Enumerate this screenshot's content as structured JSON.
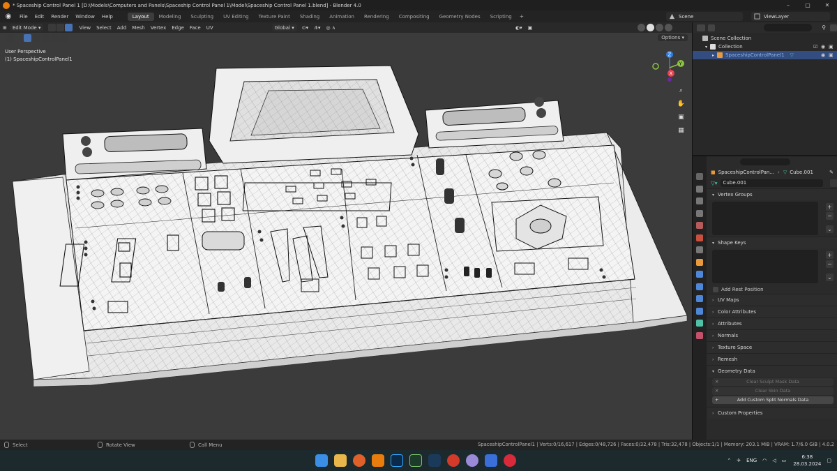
{
  "window": {
    "title": "* Spaceship Control Panel 1 [D:\\Models\\Computers and Panels\\Spaceship Control Panel 1\\Model\\Spaceship Control Panel 1.blend] - Blender 4.0"
  },
  "menu": [
    "File",
    "Edit",
    "Render",
    "Window",
    "Help"
  ],
  "workspaces": [
    "Layout",
    "Modeling",
    "Sculpting",
    "UV Editing",
    "Texture Paint",
    "Shading",
    "Animation",
    "Rendering",
    "Compositing",
    "Geometry Nodes",
    "Scripting"
  ],
  "active_workspace": "Layout",
  "scene": "Scene",
  "view_layer": "ViewLayer",
  "viewport": {
    "mode": "Edit Mode",
    "menus": [
      "View",
      "Select",
      "Add",
      "Mesh",
      "Vertex",
      "Edge",
      "Face",
      "UV"
    ],
    "orientation": "Global",
    "options_label": "Options",
    "info_line1": "User Perspective",
    "info_line2": "(1) SpaceshipControlPanel1",
    "gizmo_axes": {
      "x": "X",
      "y": "Y",
      "z": "Z"
    }
  },
  "outliner": {
    "rows": [
      {
        "label": "Scene Collection"
      },
      {
        "label": "Collection"
      },
      {
        "label": "SpaceshipControlPanel1"
      }
    ]
  },
  "properties": {
    "object_name": "SpaceshipControlPan...",
    "mesh_crumb": "Cube.001",
    "mesh_name": "Cube.001",
    "panels": {
      "vertex_groups": "Vertex Groups",
      "shape_keys": "Shape Keys",
      "add_rest_position": "Add Rest Position",
      "uv_maps": "UV Maps",
      "color_attributes": "Color Attributes",
      "attributes": "Attributes",
      "normals": "Normals",
      "texture_space": "Texture Space",
      "remesh": "Remesh",
      "geometry_data": "Geometry Data",
      "custom_properties": "Custom Properties"
    },
    "geometry_buttons": {
      "clear_sculpt": "Clear Sculpt Mask Data",
      "clear_skin": "Clear Skin Data",
      "add_split_normals": "Add Custom Split Normals Data"
    }
  },
  "status": {
    "select": "Select",
    "rotate": "Rotate View",
    "call_menu": "Call Menu",
    "stats": "SpaceshipControlPanel1 | Verts:0/16,617 | Edges:0/48,726 | Faces:0/32,478 | Tris:32,478 | Objects:1/1 | Memory: 203.1 MiB | VRAM: 1.7/6.0 GiB | 4.0.2"
  },
  "taskbar": {
    "lang": "ENG",
    "time": "6:38",
    "date": "28.03.2024"
  },
  "colors": {
    "accent": "#4772b3",
    "selected_row": "#334d80",
    "mesh_icon": "#4fc1a6"
  }
}
